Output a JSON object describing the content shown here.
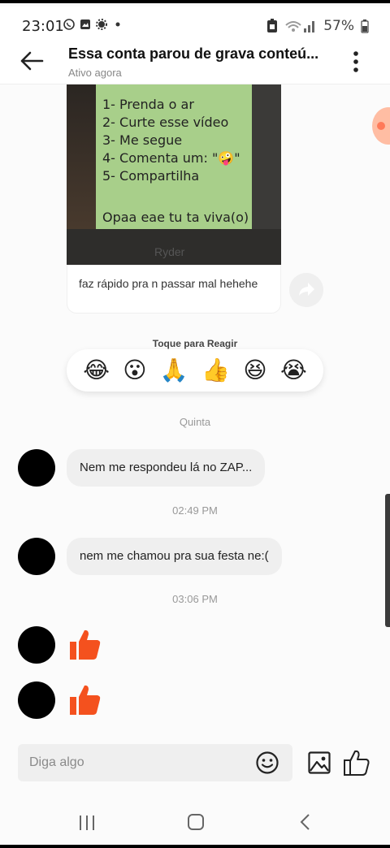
{
  "status_bar": {
    "time": "23:01",
    "battery": "57%"
  },
  "header": {
    "title": "Essa conta parou de grava conteú...",
    "subtitle": "Ativo agora"
  },
  "shared_post": {
    "lines": [
      "1- Prenda o ar",
      "2- Curte esse vídeo",
      "3- Me segue",
      "4- Comenta um: \"🤪\"",
      "5- Compartilha"
    ],
    "last_line": "Opaa eae tu ta viva(o)",
    "watermark": "Ryder",
    "caption": "faz rápido pra n passar mal hehehe"
  },
  "reactions": {
    "label": "Toque para Reagir",
    "emojis": [
      "😂",
      "😮",
      "🙏",
      "👍",
      "😆",
      "😭"
    ]
  },
  "messages": [
    {
      "type": "date",
      "text": "Quinta"
    },
    {
      "type": "text",
      "text": "Nem me respondeu lá no ZAP..."
    },
    {
      "type": "date",
      "text": "02:49 PM"
    },
    {
      "type": "text",
      "text": "nem me chamou pra sua festa ne:("
    },
    {
      "type": "date",
      "text": "03:06 PM"
    },
    {
      "type": "like"
    },
    {
      "type": "like"
    }
  ],
  "composer": {
    "placeholder": "Diga algo"
  },
  "colors": {
    "like_orange": "#f4511e",
    "bubble_gray": "#efefef",
    "post_green": "#a8cf8a"
  }
}
